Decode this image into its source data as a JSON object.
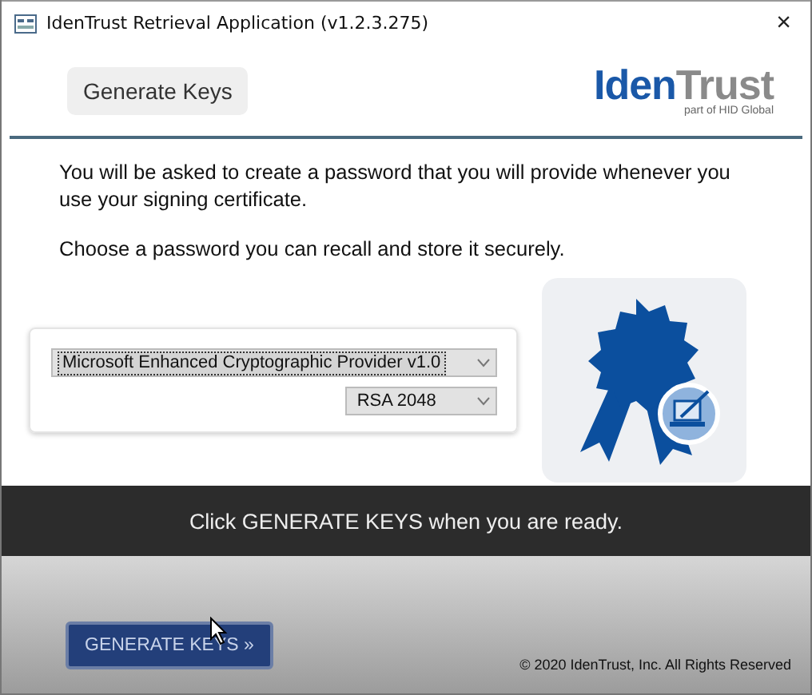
{
  "window": {
    "title": "IdenTrust Retrieval Application (v1.2.3.275)",
    "close": "×"
  },
  "header": {
    "step_label": "Generate Keys",
    "logo": {
      "part_1": "Iden",
      "part_2": "Trust",
      "tagline": "part of HID Global"
    }
  },
  "instructions": [
    "You will be asked to create a password that you will provide whenever you use your signing certificate.",
    "Choose a password you can recall and store it securely."
  ],
  "dropdowns": [
    {
      "kind": "provider",
      "value": "Microsoft Enhanced Cryptographic Provider v1.0",
      "focused": true
    },
    {
      "kind": "key_size",
      "value": "RSA 2048",
      "focused": false
    }
  ],
  "banner": "Click GENERATE KEYS when you are ready.",
  "footer": {
    "button": "GENERATE KEYS »",
    "copyright": "© 2020 IdenTrust, Inc. All Rights Reserved"
  }
}
